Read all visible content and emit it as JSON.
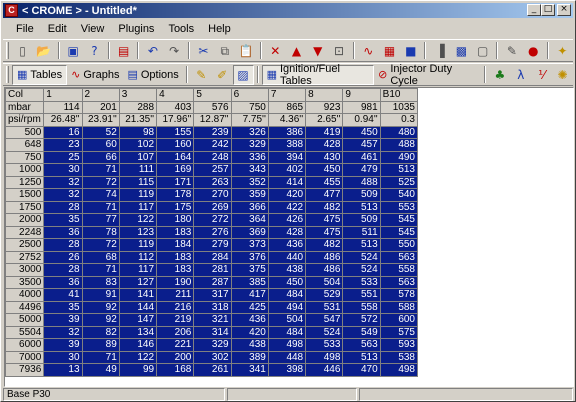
{
  "window": {
    "title": "< CROME > - Untitled*"
  },
  "title_buttons": {
    "minimize": "_",
    "maximize": "□",
    "close": "×"
  },
  "menu": [
    "File",
    "Edit",
    "View",
    "Plugins",
    "Tools",
    "Help"
  ],
  "toolbar2": {
    "tables": "Tables",
    "graphs": "Graphs",
    "options": "Options",
    "ignition_fuel": "Ignition/Fuel Tables",
    "injector_duty": "Injector Duty Cycle"
  },
  "table": {
    "col_label": "Col",
    "mbar_label": "mbar",
    "psi_label": "psi/rpm",
    "columns": [
      "1",
      "2",
      "3",
      "4",
      "5",
      "6",
      "7",
      "8",
      "9",
      "B10"
    ],
    "mbar": [
      "114",
      "201",
      "288",
      "403",
      "576",
      "750",
      "865",
      "923",
      "981",
      "1035"
    ],
    "psi": [
      "26.48''",
      "23.91''",
      "21.35''",
      "17.96''",
      "12.87''",
      "7.75''",
      "4.36''",
      "2.65''",
      "0.94''",
      "0.3"
    ],
    "rows": [
      {
        "rpm": "500",
        "values": [
          "16",
          "52",
          "98",
          "155",
          "239",
          "326",
          "386",
          "419",
          "450",
          "480"
        ]
      },
      {
        "rpm": "648",
        "values": [
          "23",
          "60",
          "102",
          "160",
          "242",
          "329",
          "388",
          "428",
          "457",
          "488"
        ]
      },
      {
        "rpm": "750",
        "values": [
          "25",
          "66",
          "107",
          "164",
          "248",
          "336",
          "394",
          "430",
          "461",
          "490"
        ]
      },
      {
        "rpm": "1000",
        "values": [
          "30",
          "71",
          "111",
          "169",
          "257",
          "343",
          "402",
          "450",
          "479",
          "513"
        ]
      },
      {
        "rpm": "1250",
        "values": [
          "32",
          "72",
          "115",
          "171",
          "263",
          "352",
          "414",
          "455",
          "488",
          "525"
        ]
      },
      {
        "rpm": "1500",
        "values": [
          "32",
          "74",
          "119",
          "178",
          "270",
          "359",
          "420",
          "477",
          "509",
          "540"
        ]
      },
      {
        "rpm": "1750",
        "values": [
          "28",
          "71",
          "117",
          "175",
          "269",
          "366",
          "422",
          "482",
          "513",
          "553"
        ]
      },
      {
        "rpm": "2000",
        "values": [
          "35",
          "77",
          "122",
          "180",
          "272",
          "364",
          "426",
          "475",
          "509",
          "545"
        ]
      },
      {
        "rpm": "2248",
        "values": [
          "36",
          "78",
          "123",
          "183",
          "276",
          "369",
          "428",
          "475",
          "511",
          "545"
        ]
      },
      {
        "rpm": "2500",
        "values": [
          "28",
          "72",
          "119",
          "184",
          "279",
          "373",
          "436",
          "482",
          "513",
          "550"
        ]
      },
      {
        "rpm": "2752",
        "values": [
          "26",
          "68",
          "112",
          "183",
          "284",
          "376",
          "440",
          "486",
          "524",
          "563"
        ]
      },
      {
        "rpm": "3000",
        "values": [
          "28",
          "71",
          "117",
          "183",
          "281",
          "375",
          "438",
          "486",
          "524",
          "558"
        ]
      },
      {
        "rpm": "3500",
        "values": [
          "36",
          "83",
          "127",
          "190",
          "287",
          "385",
          "450",
          "504",
          "533",
          "563"
        ]
      },
      {
        "rpm": "4000",
        "values": [
          "41",
          "91",
          "141",
          "211",
          "317",
          "417",
          "484",
          "529",
          "551",
          "578"
        ]
      },
      {
        "rpm": "4496",
        "values": [
          "35",
          "92",
          "144",
          "216",
          "318",
          "425",
          "494",
          "531",
          "558",
          "588"
        ]
      },
      {
        "rpm": "5000",
        "values": [
          "39",
          "92",
          "147",
          "219",
          "321",
          "436",
          "504",
          "547",
          "572",
          "600"
        ]
      },
      {
        "rpm": "5504",
        "values": [
          "32",
          "82",
          "134",
          "206",
          "314",
          "420",
          "484",
          "524",
          "549",
          "575"
        ]
      },
      {
        "rpm": "6000",
        "values": [
          "39",
          "89",
          "146",
          "221",
          "329",
          "438",
          "498",
          "533",
          "563",
          "593"
        ]
      },
      {
        "rpm": "7000",
        "values": [
          "30",
          "71",
          "122",
          "200",
          "302",
          "389",
          "448",
          "498",
          "513",
          "538"
        ]
      },
      {
        "rpm": "7936",
        "values": [
          "13",
          "49",
          "99",
          "168",
          "261",
          "341",
          "398",
          "446",
          "470",
          "498"
        ]
      }
    ]
  },
  "status": {
    "panel1": "Base P30",
    "panel2": "",
    "panel3": ""
  },
  "colors": {
    "cell_bg": "#0a1e8c",
    "title_start": "#0a246a",
    "title_end": "#a6caf0",
    "chrome": "#d4d0c8"
  }
}
